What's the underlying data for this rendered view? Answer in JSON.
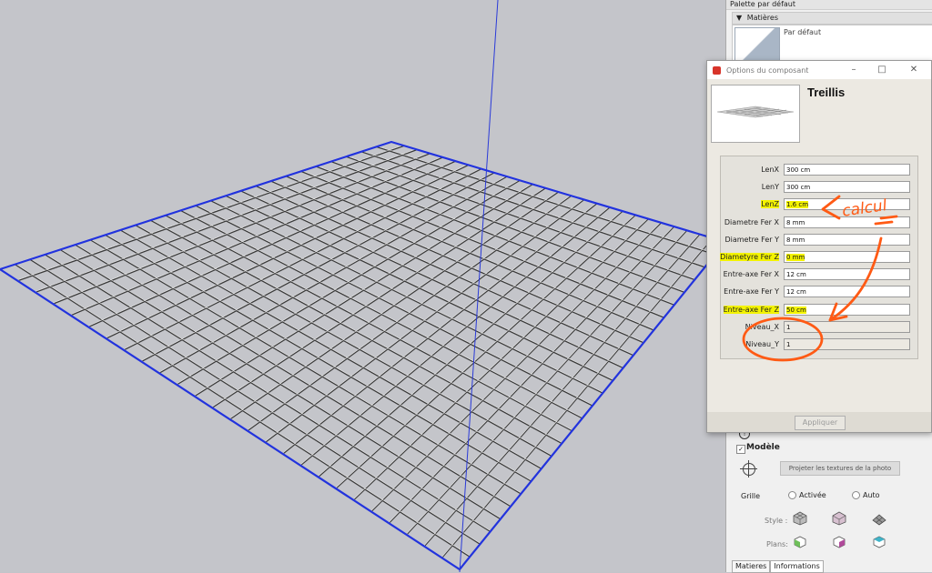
{
  "tray": {
    "title": "Palette par défaut",
    "section": "Matières",
    "material_name": "Par défaut",
    "model_label": "Modèle",
    "project_button": "Projeter les textures de la photo",
    "grid_label": "Grille",
    "grid_on": "Activée",
    "grid_auto": "Auto",
    "style_label": "Style :",
    "planes_label": "Plans:",
    "tabs": [
      "Matieres",
      "Informations"
    ]
  },
  "dialog": {
    "title": "Options du composant",
    "component_name": "Treillis",
    "apply_button": "Appliquer",
    "fields": [
      {
        "label": "LenX",
        "value": "300 cm",
        "highlight": false
      },
      {
        "label": "LenY",
        "value": "300 cm",
        "highlight": false
      },
      {
        "label": "LenZ",
        "value": "1.6 cm",
        "highlight": true
      },
      {
        "label": "Diametre Fer X",
        "value": "8 mm",
        "highlight": false
      },
      {
        "label": "Diametre Fer Y",
        "value": "8 mm",
        "highlight": false
      },
      {
        "label": "Diametyre Fer Z",
        "value": "0 mm",
        "highlight": true
      },
      {
        "label": "Entre-axe Fer X",
        "value": "12 cm",
        "highlight": false
      },
      {
        "label": "Entre-axe Fer Y",
        "value": "12 cm",
        "highlight": false
      },
      {
        "label": "Entre-axe Fer Z",
        "value": "50 cm",
        "highlight": true
      },
      {
        "label": "Niveau_X",
        "value": "1",
        "highlight": false
      },
      {
        "label": "Niveau_Y",
        "value": "1",
        "highlight": false
      }
    ]
  },
  "annotation": {
    "handwritten_text": "calcul"
  },
  "colors": {
    "viewport_bg": "#c4c5ca",
    "mesh_edge": "#2233dd",
    "highlight": "#f3f300",
    "annotation": "#ff5a14"
  }
}
